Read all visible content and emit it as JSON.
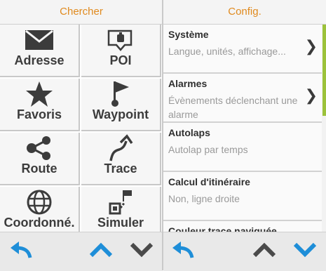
{
  "left": {
    "header": "Chercher",
    "tiles": [
      {
        "label": "Adresse",
        "icon": "envelope-icon"
      },
      {
        "label": "POI",
        "icon": "poi-icon"
      },
      {
        "label": "Favoris",
        "icon": "star-icon"
      },
      {
        "label": "Waypoint",
        "icon": "flag-icon"
      },
      {
        "label": "Route",
        "icon": "route-icon"
      },
      {
        "label": "Trace",
        "icon": "trace-icon"
      },
      {
        "label": "Coordonné.",
        "icon": "globe-icon"
      },
      {
        "label": "Simuler",
        "icon": "simulate-icon"
      }
    ],
    "footer": {
      "back_icon": "back-arrow-icon",
      "up_icon": "chevron-up-icon",
      "down_icon": "chevron-down-icon"
    }
  },
  "right": {
    "header": "Config.",
    "items": [
      {
        "title": "Système",
        "subtitle": "Langue, unités, affichage...",
        "has_arrow": true
      },
      {
        "title": "Alarmes",
        "subtitle": "Évènements déclenchant une alarme",
        "has_arrow": true
      },
      {
        "title": "Autolaps",
        "subtitle": "Autolap par temps",
        "has_arrow": false
      },
      {
        "title": "Calcul d'itinéraire",
        "subtitle": "Non, ligne droite",
        "has_arrow": false
      },
      {
        "title": "Couleur trace naviguée",
        "subtitle": "",
        "has_arrow": false
      }
    ],
    "footer": {
      "back_icon": "back-arrow-icon",
      "up_icon": "chevron-up-icon",
      "down_icon": "chevron-down-icon"
    }
  },
  "colors": {
    "header_text": "#e08a1e",
    "accent_blue": "#1e8ed8",
    "scroll_green": "#9cc23a",
    "icon_dark": "#3c3c3c"
  }
}
